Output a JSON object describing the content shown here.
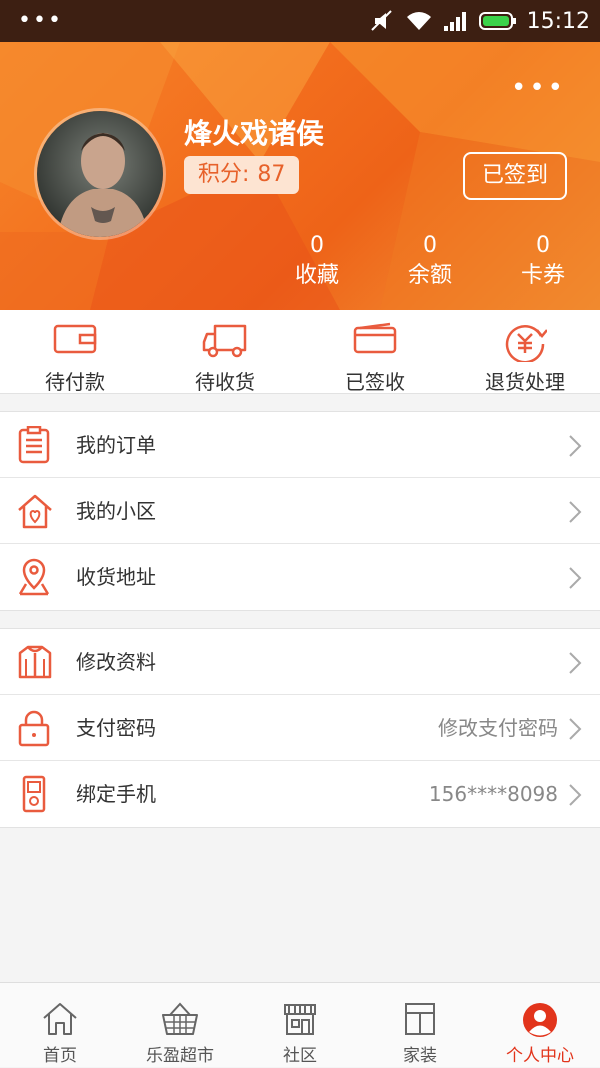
{
  "status_bar": {
    "time": "15:12"
  },
  "profile": {
    "username": "烽火戏诸侯",
    "points_label": "积分:",
    "points_value": "87",
    "signin_label": "已签到",
    "more_label": "•••"
  },
  "stats": [
    {
      "value": "0",
      "label": "收藏"
    },
    {
      "value": "0",
      "label": "余额"
    },
    {
      "value": "0",
      "label": "卡券"
    }
  ],
  "orders": [
    {
      "label": "待付款",
      "icon": "wallet-icon"
    },
    {
      "label": "待收货",
      "icon": "truck-icon"
    },
    {
      "label": "已签收",
      "icon": "card-icon"
    },
    {
      "label": "退货处理",
      "icon": "refund-icon"
    }
  ],
  "menu_group_1": [
    {
      "label": "我的订单",
      "value": "",
      "icon": "clipboard-icon"
    },
    {
      "label": "我的小区",
      "value": "",
      "icon": "house-icon"
    },
    {
      "label": "收货地址",
      "value": "",
      "icon": "location-pin-icon"
    }
  ],
  "menu_group_2": [
    {
      "label": "修改资料",
      "value": "",
      "icon": "shirt-icon"
    },
    {
      "label": "支付密码",
      "value": "修改支付密码",
      "icon": "lock-icon"
    },
    {
      "label": "绑定手机",
      "value": "156****8098",
      "icon": "phone-icon"
    }
  ],
  "tabs": [
    {
      "label": "首页",
      "icon": "home-icon",
      "active": false
    },
    {
      "label": "乐盈超市",
      "icon": "basket-icon",
      "active": false
    },
    {
      "label": "社区",
      "icon": "store-icon",
      "active": false
    },
    {
      "label": "家装",
      "icon": "layout-icon",
      "active": false
    },
    {
      "label": "个人中心",
      "icon": "user-icon",
      "active": true
    }
  ],
  "colors": {
    "accent": "#e2341b",
    "header_orange": "#f26d1d",
    "icon_red": "#e95b3e"
  }
}
